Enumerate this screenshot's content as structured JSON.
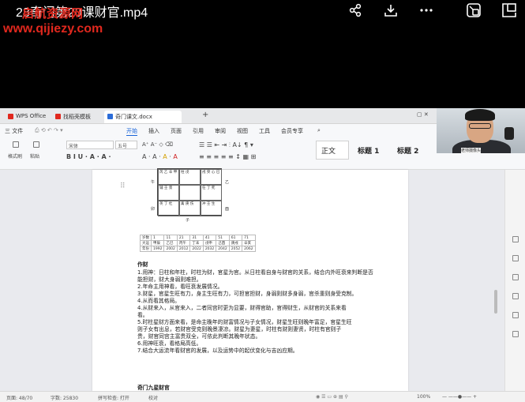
{
  "player": {
    "title": "28奇门第20课财官.mp4",
    "watermark_site_name": "启航资源网",
    "watermark_url": "www.qijiezy.com",
    "icons": [
      "share-icon",
      "download-icon",
      "more-icon",
      "pip-icon",
      "fullscreen-icon"
    ]
  },
  "tabs": [
    {
      "label": "WPS Office",
      "icon": "wps-icon",
      "color": "#e0281e"
    },
    {
      "label": "找稻壳模板",
      "icon": "docer-icon",
      "color": "#e0281e"
    },
    {
      "label": "奇门课文.docx",
      "icon": "word-doc-icon",
      "color": "#2b6cd8"
    }
  ],
  "ribbon": {
    "file_menu": "三 文件",
    "menus": [
      "开始",
      "插入",
      "页面",
      "引用",
      "审阅",
      "视图",
      "工具",
      "会员专享"
    ],
    "active_menu": "开始",
    "format_painter": "格式刷",
    "paste": "粘贴",
    "font_name": "宋体",
    "font_size": "五号",
    "styles": [
      "正文",
      "标题 1",
      "标题 2"
    ],
    "search_icon": "search-icon"
  },
  "document": {
    "grid_side_labels": [
      "午",
      "卯",
      "子",
      "酉"
    ],
    "grid_right_label": "乙",
    "grid_cells": [
      "芮 乙 辛 甲",
      "柱 戊",
      "戌 癸 心 已",
      "辅 壬 景",
      "",
      "任 丁 死",
      "英 丁 杜",
      "禽 庚 伤",
      "冲 壬 生"
    ],
    "age_table": [
      [
        "岁数",
        "1",
        "11",
        "21",
        "31",
        "41",
        "51",
        "61",
        "71"
      ],
      [
        "大运",
        "甲辰",
        "乙巳",
        "丙午",
        "丁未",
        "戊申",
        "己酉",
        "庚戌",
        "辛亥"
      ],
      [
        "年份",
        "1992",
        "2002",
        "2012",
        "2022",
        "2032",
        "2042",
        "2052",
        "2062"
      ]
    ],
    "heading": "作财",
    "lines": [
      "1.用神：日柱和年柱，时柱为财，官星为官。从日柱看自身与财官的关系，结合内外旺衰来判断是否",
      "能担财，财大身弱则难担。",
      "2.年命主用神看，看旺衰发展情况。",
      "3.财星，官星生旺有力，身主生旺有力，可担官担财，身弱则财多身弱，官杀重则身受克制。",
      "4.从而看其格局。",
      "4.从财来入，从官来入，二者同宫时更为显要，财得官助，官得财生，从财官的关系来看",
      "看。",
      "5.时柱星财方面来看，是命主晚年的财富情况与子女情况，财星生旺则晚年富足，官星生旺",
      "则子女有出息，若财官受克则晚景凄凉。财星为妻星，时柱有财则妻贤，时柱有官则子",
      "贵，财官同宫主富贵双全，可依此判断其晚年状态。",
      "6.用神旺衰，看格局高低。",
      "7.结合大运流年看财官的发展，以及运势中的起伏变化与吉凶应期。"
    ],
    "footer_heading": "奇门九星财官"
  },
  "status": {
    "page": "页面: 48/70",
    "words": "字数: 25830",
    "spellcheck": "拼写检查: 打开",
    "proofread": "校对",
    "zoom": "100%"
  },
  "webcam": {
    "label": "老师摄像头"
  }
}
